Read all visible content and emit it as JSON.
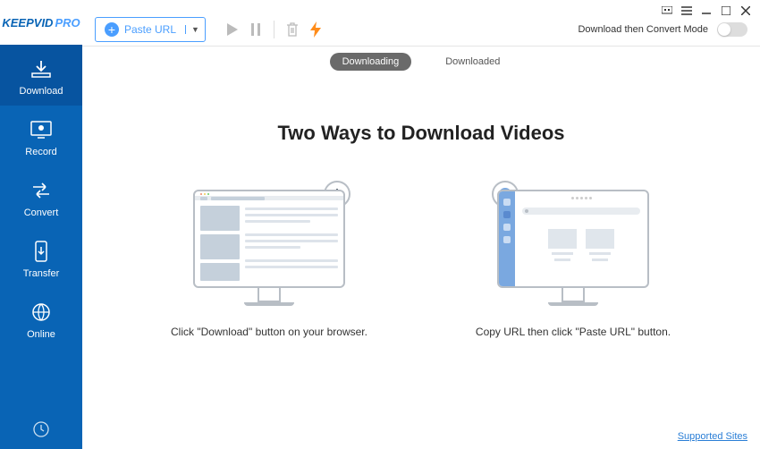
{
  "logo": {
    "part1": "KEEPVID",
    "part2": "PRO"
  },
  "sidebar": {
    "items": [
      {
        "label": "Download"
      },
      {
        "label": "Record"
      },
      {
        "label": "Convert"
      },
      {
        "label": "Transfer"
      },
      {
        "label": "Online"
      }
    ]
  },
  "toolbar": {
    "paste_label": "Paste URL",
    "convert_mode_label": "Download then Convert Mode"
  },
  "tabs": {
    "downloading": "Downloading",
    "downloaded": "Downloaded"
  },
  "content": {
    "headline": "Two Ways to Download Videos",
    "method1_caption": "Click \"Download\" button on your browser.",
    "method2_caption": "Copy URL then click \"Paste URL\" button."
  },
  "footer": {
    "supported_sites": "Supported Sites"
  }
}
